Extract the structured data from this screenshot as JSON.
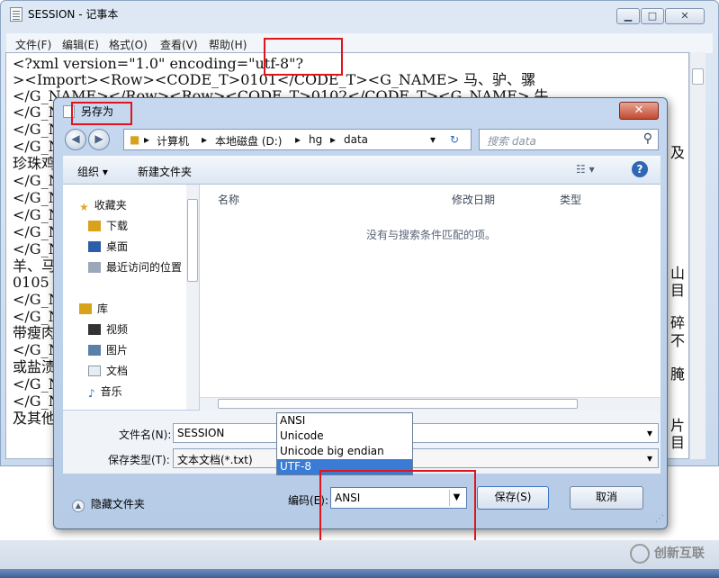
{
  "notepad": {
    "title": "SESSION - 记事本",
    "menu": [
      "文件(F)",
      "编辑(E)",
      "格式(O)",
      "查看(V)",
      "帮助(H)"
    ],
    "lines": [
      "<?xml version=\"1.0\" encoding=\"utf-8\"?",
      "><Import><Row><CODE_T>0101</CODE_T><G_NAME> 马、驴、骡",
      "</G_NAME></Row><Row><CODE_T>0102</CODE_T><G_NAME> 牛",
      "</G_N",
      "</G_N",
      "</G_N",
      "珍珠鸡",
      "</G_N",
      "</G_N",
      "</G_N",
      "</G_N",
      "</G_N",
      "羊、马",
      "0105",
      "</G_N",
      "</G_N",
      "带瘦肉",
      "</G_N",
      "或盐渍",
      "</G_N",
      "</G_N",
      "及其他"
    ],
    "right_fragments": [
      "及",
      "山",
      "目",
      "碎",
      "不",
      "腌",
      "片",
      "目"
    ]
  },
  "dialog": {
    "title": "另存为",
    "breadcrumbs": [
      "计算机",
      "本地磁盘 (D:)",
      "hg",
      "data"
    ],
    "search_placeholder": "搜索 data",
    "toolbar": {
      "organize": "组织 ▾",
      "new_folder": "新建文件夹"
    },
    "nav_items": [
      "收藏夹",
      "下载",
      "桌面",
      "最近访问的位置",
      "库",
      "视频",
      "图片",
      "文档",
      "音乐"
    ],
    "columns": [
      "名称",
      "修改日期",
      "类型"
    ],
    "empty_message": "没有与搜索条件匹配的项。",
    "filename_label": "文件名(N):",
    "filename_value": "SESSION",
    "filetype_label": "保存类型(T):",
    "filetype_value": "文本文档(*.txt)",
    "hide_folders": "隐藏文件夹",
    "encoding_label": "编码(E):",
    "encoding_value": "ANSI",
    "encoding_options": [
      "ANSI",
      "Unicode",
      "Unicode big endian",
      "UTF-8"
    ],
    "save_button": "保存(S)",
    "cancel_button": "取消"
  },
  "watermark": "创新互联",
  "colors": {
    "highlight": "#e0151c",
    "selection": "#3a7bd5"
  }
}
